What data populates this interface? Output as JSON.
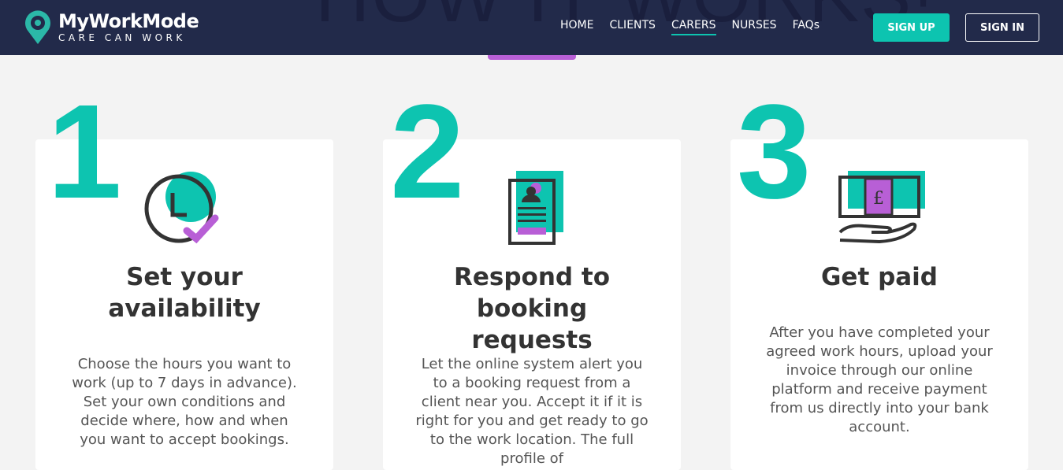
{
  "header": {
    "background_title": "HOW IT WORKS!",
    "logo": {
      "name": "MyWorkMode",
      "tagline": "CARE CAN WORK"
    },
    "nav": [
      {
        "label": "HOME",
        "active": false
      },
      {
        "label": "CLIENTS",
        "active": false
      },
      {
        "label": "CARERS",
        "active": true
      },
      {
        "label": "NURSES",
        "active": false
      },
      {
        "label": "FAQs",
        "active": false
      }
    ],
    "signup_label": "SIGN UP",
    "signin_label": "SIGN IN"
  },
  "colors": {
    "navy": "#222a4a",
    "teal": "#0dc4b0",
    "purple": "#b85fd6"
  },
  "steps": [
    {
      "number": "1",
      "icon": "clock-check-icon",
      "title": "Set your availability",
      "text": "Choose the hours you want to work (up to 7 days in advance). Set your own conditions and decide where, how and when you want to accept bookings."
    },
    {
      "number": "2",
      "icon": "profile-document-icon",
      "title": "Respond to booking requests",
      "text": "Let the online system alert you to a booking request from a client near you. Accept it if it is right for you and get ready to go to the work location. The full profile of"
    },
    {
      "number": "3",
      "icon": "payment-hand-icon",
      "title": "Get paid",
      "text": "After you have completed your agreed work hours, upload your invoice through our online platform and receive payment from us directly into your bank account."
    }
  ]
}
